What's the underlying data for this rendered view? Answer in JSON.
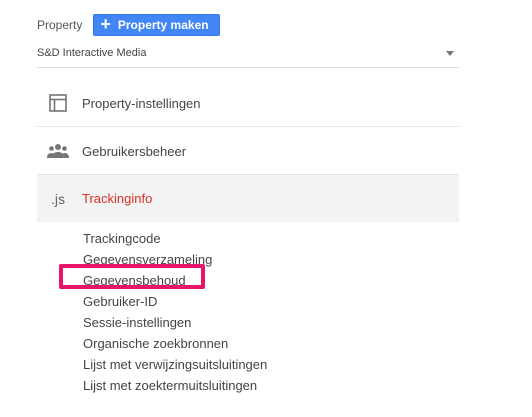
{
  "property": {
    "label": "Property",
    "create_button_label": "Property maken",
    "selected_property": "S&D Interactive Media"
  },
  "nav": {
    "items": [
      {
        "label": "Property-instellingen",
        "icon": "property-settings-icon"
      },
      {
        "label": "Gebruikersbeheer",
        "icon": "users-icon"
      },
      {
        "label": "Trackinginfo",
        "icon": "js-icon",
        "icon_text": ".js",
        "active": true
      }
    ]
  },
  "tracking_submenu": {
    "items": [
      "Trackingcode",
      "Gegevensverzameling",
      "Gegevensbehoud",
      "Gebruiker-ID",
      "Sessie-instellingen",
      "Organische zoekbronnen",
      "Lijst met verwijzingsuitsluitingen",
      "Lijst met zoektermuitsluitingen"
    ],
    "highlighted_item": "Gegevensbehoud"
  },
  "colors": {
    "primary_button": "#4285f4",
    "active_text": "#d93025",
    "highlight": "#e8156a"
  }
}
